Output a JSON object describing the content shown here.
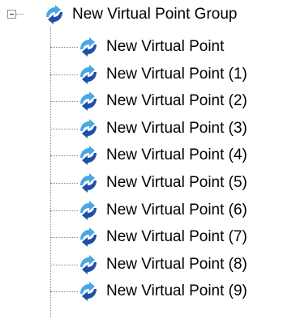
{
  "tree": {
    "root": {
      "label": "New Virtual Point Group",
      "icon": "virtual-point-group-icon",
      "expanded": true
    },
    "children": [
      {
        "label": "New Virtual Point",
        "icon": "virtual-point-icon"
      },
      {
        "label": "New Virtual Point (1)",
        "icon": "virtual-point-icon"
      },
      {
        "label": "New Virtual Point (2)",
        "icon": "virtual-point-icon"
      },
      {
        "label": "New Virtual Point (3)",
        "icon": "virtual-point-icon"
      },
      {
        "label": "New Virtual Point (4)",
        "icon": "virtual-point-icon"
      },
      {
        "label": "New Virtual Point (5)",
        "icon": "virtual-point-icon"
      },
      {
        "label": "New Virtual Point (6)",
        "icon": "virtual-point-icon"
      },
      {
        "label": "New Virtual Point (7)",
        "icon": "virtual-point-icon"
      },
      {
        "label": "New Virtual Point (8)",
        "icon": "virtual-point-icon"
      },
      {
        "label": "New Virtual Point (9)",
        "icon": "virtual-point-icon"
      }
    ]
  },
  "colors": {
    "icon_dark_blue": "#1f4fa8",
    "icon_light_blue": "#4aa7e3",
    "connector_dots": "#8a8a8a"
  }
}
